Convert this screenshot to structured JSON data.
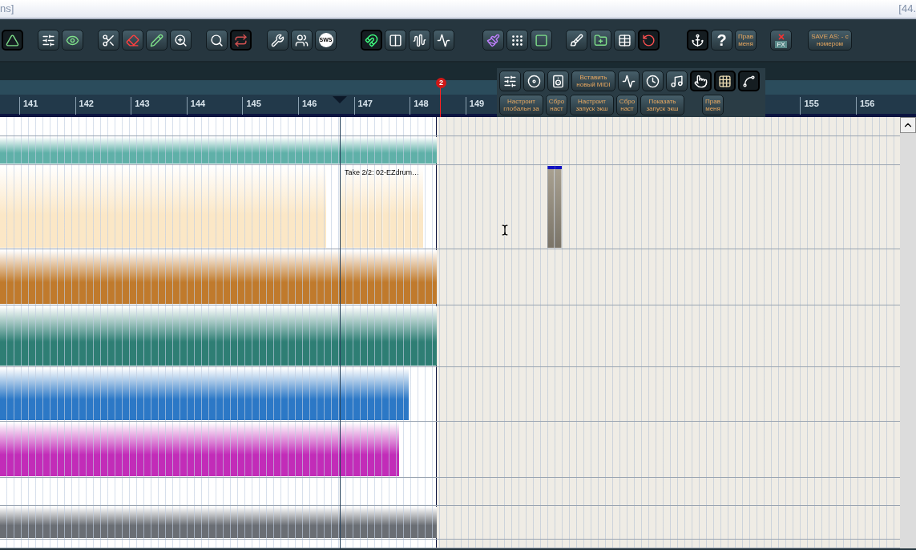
{
  "title_bar": {
    "left_text": "ns]",
    "right_text": "[44."
  },
  "toolbar": {
    "groups": [
      [
        {
          "kind": "icon",
          "active": true
        }
      ],
      [
        {
          "kind": "icon",
          "active": false
        },
        {
          "kind": "icon",
          "active": false
        }
      ],
      [
        {
          "kind": "icon",
          "active": false
        },
        {
          "kind": "icon",
          "active": false
        },
        {
          "kind": "icon",
          "active": false
        },
        {
          "kind": "icon",
          "active": false
        }
      ],
      [
        {
          "kind": "icon",
          "active": false
        },
        {
          "kind": "icon",
          "active": true
        }
      ],
      [
        {
          "kind": "icon",
          "active": false
        },
        {
          "kind": "icon",
          "active": false
        },
        {
          "kind": "badge",
          "label": "SWS",
          "active": false
        }
      ],
      [
        {
          "kind": "icon",
          "active": true
        },
        {
          "kind": "icon",
          "active": false
        },
        {
          "kind": "icon",
          "active": false
        },
        {
          "kind": "icon",
          "active": false
        }
      ],
      [
        {
          "kind": "icon",
          "active": false
        },
        {
          "kind": "icon",
          "active": false
        },
        {
          "kind": "icon",
          "active": false
        }
      ],
      [
        {
          "kind": "icon",
          "active": false
        },
        {
          "kind": "icon",
          "active": false
        },
        {
          "kind": "icon",
          "active": false
        },
        {
          "kind": "icon",
          "active": true
        }
      ],
      [
        {
          "kind": "icon",
          "active": true
        },
        {
          "kind": "glyph",
          "label": "?",
          "active": false
        },
        {
          "kind": "text",
          "label": "Прав меня",
          "active": false
        }
      ],
      [
        {
          "kind": "fx",
          "label": "FX",
          "active": false
        }
      ],
      [
        {
          "kind": "wide",
          "label": "SAVE AS: - с номером",
          "active": false
        }
      ]
    ]
  },
  "floating_toolbar": {
    "upper_buttons": [
      {
        "kind": "icon",
        "active": false
      },
      {
        "kind": "icon",
        "active": false
      },
      {
        "kind": "icon",
        "active": false
      },
      {
        "kind": "wide",
        "label": "Вставить новый MIDI",
        "active": false
      },
      {
        "kind": "icon",
        "active": false
      },
      {
        "kind": "icon",
        "active": false
      },
      {
        "kind": "icon",
        "active": false
      },
      {
        "kind": "icon",
        "active": true
      },
      {
        "kind": "icon",
        "active": true
      },
      {
        "kind": "icon",
        "active": true
      }
    ],
    "lower_buttons": [
      {
        "kind": "wide",
        "label": "Настроит глобальн за",
        "active": false
      },
      {
        "kind": "text",
        "label": "Сбро наст",
        "active": false
      },
      {
        "kind": "wide",
        "label": "Настроит запуск экш",
        "active": false
      },
      {
        "kind": "text",
        "label": "Сбро наст",
        "active": false
      },
      {
        "kind": "wide",
        "label": "Показать запуск экш",
        "active": false
      },
      {
        "kind": "spacer"
      },
      {
        "kind": "text",
        "label": "Прав меня",
        "active": false
      }
    ]
  },
  "ruler": {
    "marker": "2",
    "bars": [
      "141",
      "142",
      "143",
      "144",
      "145",
      "146",
      "147",
      "148",
      "149",
      "155",
      "156"
    ]
  },
  "tracks": [
    {
      "kind": "empty"
    },
    {
      "kind": "media",
      "items": [
        {
          "color": "#5fb0a8"
        }
      ]
    },
    {
      "kind": "media",
      "items": [
        {
          "color": "#fbe7c6"
        },
        {
          "color": "#fbe7c6",
          "label": "Take 2/2: 02-EZdrum…"
        },
        {
          "color": "#7a7468",
          "selected": true
        }
      ]
    },
    {
      "kind": "media",
      "items": [
        {
          "color": "#c07a2c"
        }
      ]
    },
    {
      "kind": "media",
      "items": [
        {
          "color": "#2e7e74"
        }
      ]
    },
    {
      "kind": "media",
      "items": [
        {
          "color": "#2c78c6"
        }
      ]
    },
    {
      "kind": "media",
      "items": [
        {
          "color": "#c22cb8"
        }
      ]
    },
    {
      "kind": "empty"
    },
    {
      "kind": "media",
      "items": [
        {
          "color": "#6a6e74"
        }
      ]
    },
    {
      "kind": "empty"
    }
  ]
}
